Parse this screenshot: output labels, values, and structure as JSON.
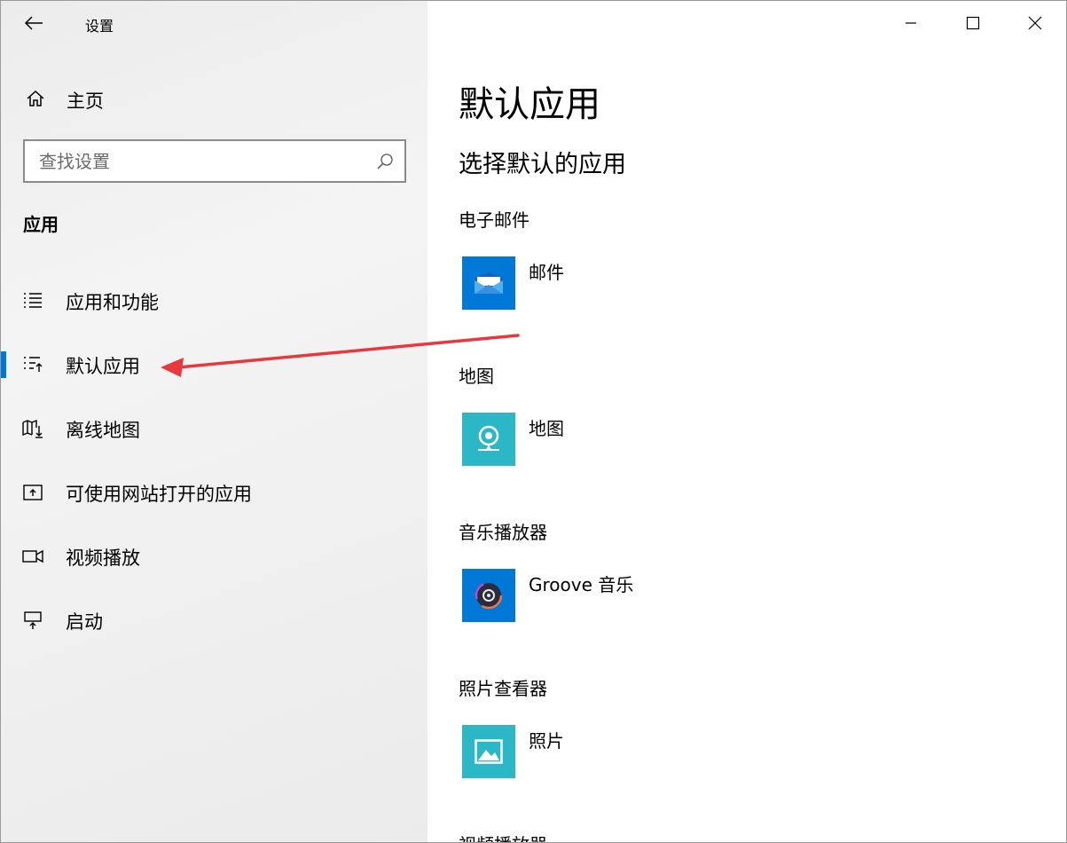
{
  "window": {
    "title": "设置",
    "controls": {
      "minimize": "minimize",
      "maximize": "maximize",
      "close": "close"
    }
  },
  "sidebar": {
    "home_label": "主页",
    "search_placeholder": "查找设置",
    "section_title": "应用",
    "items": [
      {
        "label": "应用和功能",
        "icon": "apps-list-icon",
        "selected": false
      },
      {
        "label": "默认应用",
        "icon": "default-apps-icon",
        "selected": true
      },
      {
        "label": "离线地图",
        "icon": "offline-maps-icon",
        "selected": false
      },
      {
        "label": "可使用网站打开的应用",
        "icon": "apps-for-websites-icon",
        "selected": false
      },
      {
        "label": "视频播放",
        "icon": "video-playback-icon",
        "selected": false
      },
      {
        "label": "启动",
        "icon": "startup-icon",
        "selected": false
      }
    ],
    "accent_color": "#0078d7"
  },
  "main": {
    "page_title": "默认应用",
    "subtitle": "选择默认的应用",
    "categories": [
      {
        "label": "电子邮件",
        "app_name": "邮件",
        "tile_color": "#0078d7",
        "icon": "mail-icon"
      },
      {
        "label": "地图",
        "app_name": "地图",
        "tile_color": "#2bb7c5",
        "icon": "maps-icon"
      },
      {
        "label": "音乐播放器",
        "app_name": "Groove 音乐",
        "tile_color": "#0078d7",
        "icon": "groove-music-icon"
      },
      {
        "label": "照片查看器",
        "app_name": "照片",
        "tile_color": "#2bb7c5",
        "icon": "photos-icon"
      },
      {
        "label": "视频播放器",
        "app_name": "",
        "tile_color": "",
        "icon": ""
      }
    ]
  },
  "annotation": {
    "arrow_color": "#e8383d"
  }
}
